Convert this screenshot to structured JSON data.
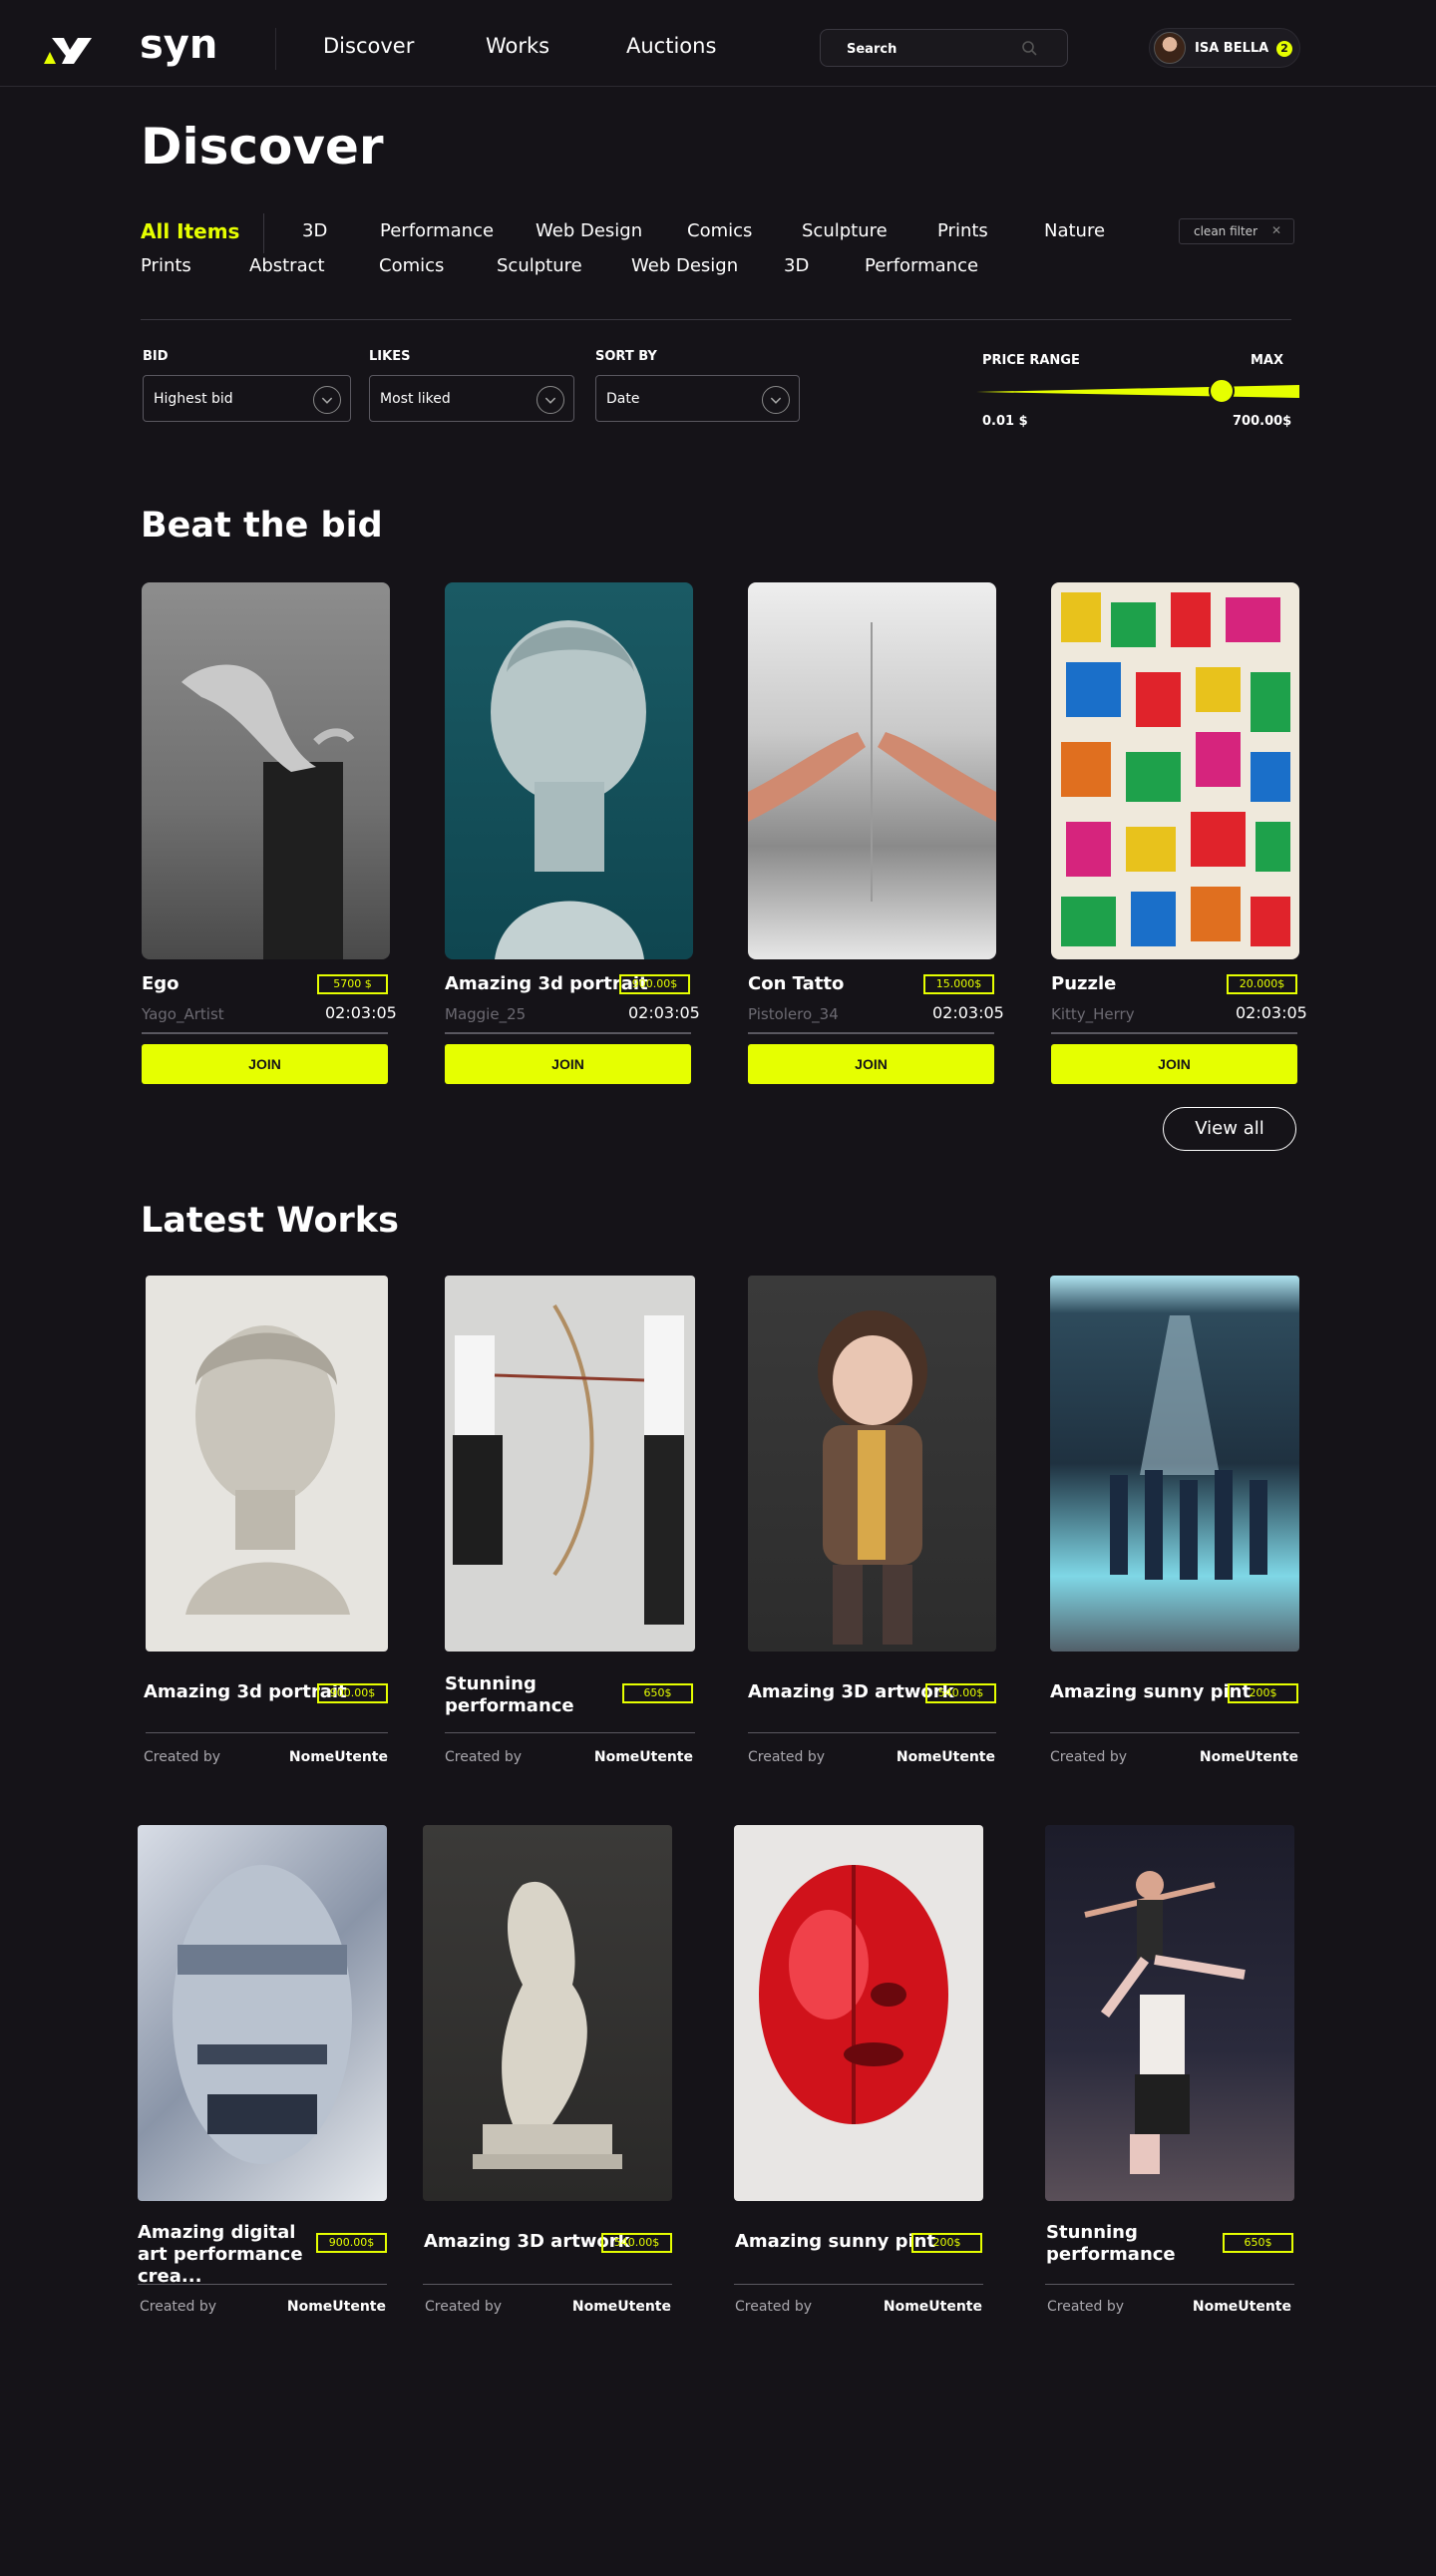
{
  "brand": "syn",
  "colors": {
    "accent": "#e6ff00",
    "background": "#151318"
  },
  "nav": {
    "links": [
      "Discover",
      "Works",
      "Auctions"
    ],
    "search_placeholder": "Search",
    "user_name": "ISA BELLA",
    "user_badge": "2"
  },
  "page_title": "Discover",
  "categories": {
    "active": "All Items",
    "row1": [
      "3D",
      "Performance",
      "Web Design",
      "Comics",
      "Sculpture",
      "Prints",
      "Nature"
    ],
    "row2": [
      "Prints",
      "Abstract",
      "Comics",
      "Sculpture",
      "Web Design",
      "3D",
      "Performance"
    ],
    "clean_filter": "clean filter",
    "clean_filter_icon": "close-icon"
  },
  "filters": {
    "bid_label": "BID",
    "bid_value": "Highest bid",
    "likes_label": "LIKES",
    "likes_value": "Most liked",
    "sort_label": "SORT BY",
    "sort_value": "Date",
    "price_range_label": "PRICE RANGE",
    "max_label": "MAX",
    "min_value": "0.01 $",
    "max_value": "700.00$",
    "slider_position_fraction": 0.78
  },
  "beat_the_bid": {
    "title": "Beat the bid",
    "join_label": "JOIN",
    "view_all": "View all",
    "cards": [
      {
        "title": "Ego",
        "price": "5700 $",
        "artist": "Yago_Artist",
        "time": "02:03:05",
        "image": "hand-sculpture-photo"
      },
      {
        "title": "Amazing 3d portrait",
        "price": "900.00$",
        "artist": "Maggie_25",
        "time": "02:03:05",
        "image": "marble-bust-photo"
      },
      {
        "title": "Con Tatto",
        "price": "15.000$",
        "artist": "Pistolero_34",
        "time": "02:03:05",
        "image": "touching-hands-photo"
      },
      {
        "title": "Puzzle",
        "price": "20.000$",
        "artist": "Kitty_Herry",
        "time": "02:03:05",
        "image": "pop-art-figures-photo"
      }
    ]
  },
  "latest_works": {
    "title": "Latest Works",
    "created_by_label": "Created by",
    "cards": [
      {
        "title": "Amazing 3d portrait",
        "price": "900.00$",
        "creator": "NomeUtente",
        "image": "plaster-bust-photo"
      },
      {
        "title": "Stunning performance",
        "price": "650$",
        "creator": "NomeUtente",
        "image": "archery-performance-photo"
      },
      {
        "title": "Amazing 3D artwork",
        "price": "540.00$",
        "creator": "NomeUtente",
        "image": "3d-character-render"
      },
      {
        "title": "Amazing sunny pint",
        "price": "200$",
        "creator": "NomeUtente",
        "image": "sea-performance-photo"
      },
      {
        "title": "Amazing digital art performance crea...",
        "price": "900.00$",
        "creator": "NomeUtente",
        "image": "mural-face-photo"
      },
      {
        "title": "Amazing 3D artwork",
        "price": "540.00$",
        "creator": "NomeUtente",
        "image": "marble-sculpture-group-photo"
      },
      {
        "title": "Amazing sunny pint",
        "price": "200$",
        "creator": "NomeUtente",
        "image": "red-head-render"
      },
      {
        "title": "Stunning performance",
        "price": "650$",
        "creator": "NomeUtente",
        "image": "ballet-dancers-photo"
      }
    ]
  }
}
